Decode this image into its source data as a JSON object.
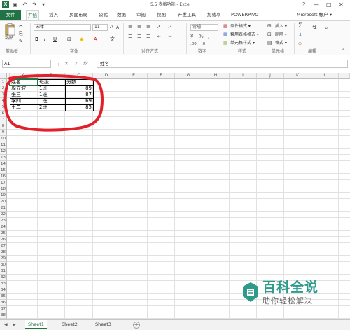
{
  "window": {
    "title": "5.5 表格功能 - Excel",
    "help": "?",
    "minimize": "—",
    "restore": "□",
    "close": "✕"
  },
  "tabs": {
    "file": "文件",
    "items": [
      "开始",
      "插入",
      "页面布局",
      "公式",
      "数据",
      "审阅",
      "视图",
      "开发工具",
      "加载项",
      "POWERPIVOT"
    ],
    "account": "Microsoft 帐户 ▾"
  },
  "ribbon": {
    "paste": "粘贴",
    "clipboard_group": "剪贴板",
    "font_name": "宋体",
    "font_size": "11",
    "font_group": "字体",
    "bold": "B",
    "italic": "I",
    "underline": "U",
    "align_group": "对齐方式",
    "number_format": "常规",
    "number_group": "数字",
    "cond_format": "条件格式 ▾",
    "table_format": "套用表格格式 ▾",
    "cell_style": "单元格样式 ▾",
    "style_group": "样式",
    "insert": "插入 ▾",
    "delete": "删除 ▾",
    "format": "格式 ▾",
    "cells_group": "单元格",
    "edit_group": "编辑"
  },
  "formula_bar": {
    "name_box": "A1",
    "formula": "姓名"
  },
  "grid": {
    "columns": [
      "A",
      "B",
      "C",
      "D",
      "E",
      "F",
      "G",
      "H",
      "I",
      "J",
      "K",
      "L"
    ],
    "rows": [
      "1",
      "2",
      "3",
      "4",
      "5",
      "6",
      "7",
      "8",
      "9",
      "10",
      "11",
      "12",
      "13",
      "14",
      "15",
      "16",
      "17",
      "18",
      "19",
      "20",
      "21",
      "22",
      "23",
      "24",
      "25",
      "26",
      "27",
      "28",
      "29",
      "30",
      "31",
      "32",
      "33",
      "34",
      "35",
      "36",
      "37",
      "38"
    ],
    "table": {
      "headers": [
        "姓名",
        "班级",
        "分数"
      ],
      "rows": [
        [
          "周立波",
          "1班",
          "89"
        ],
        [
          "张三",
          "1班",
          "87"
        ],
        [
          "李四",
          "1班",
          "69"
        ],
        [
          "王二",
          "2班",
          "85"
        ]
      ]
    }
  },
  "sheets": {
    "tabs": [
      "Sheet1",
      "Sheet2",
      "Sheet3"
    ],
    "active": 0
  },
  "watermark": {
    "title": "百科全说",
    "subtitle": "助你轻松解决"
  },
  "colors": {
    "excel_green": "#217346",
    "annotation_red": "#e0202a",
    "watermark_teal": "#2e9a8a"
  }
}
